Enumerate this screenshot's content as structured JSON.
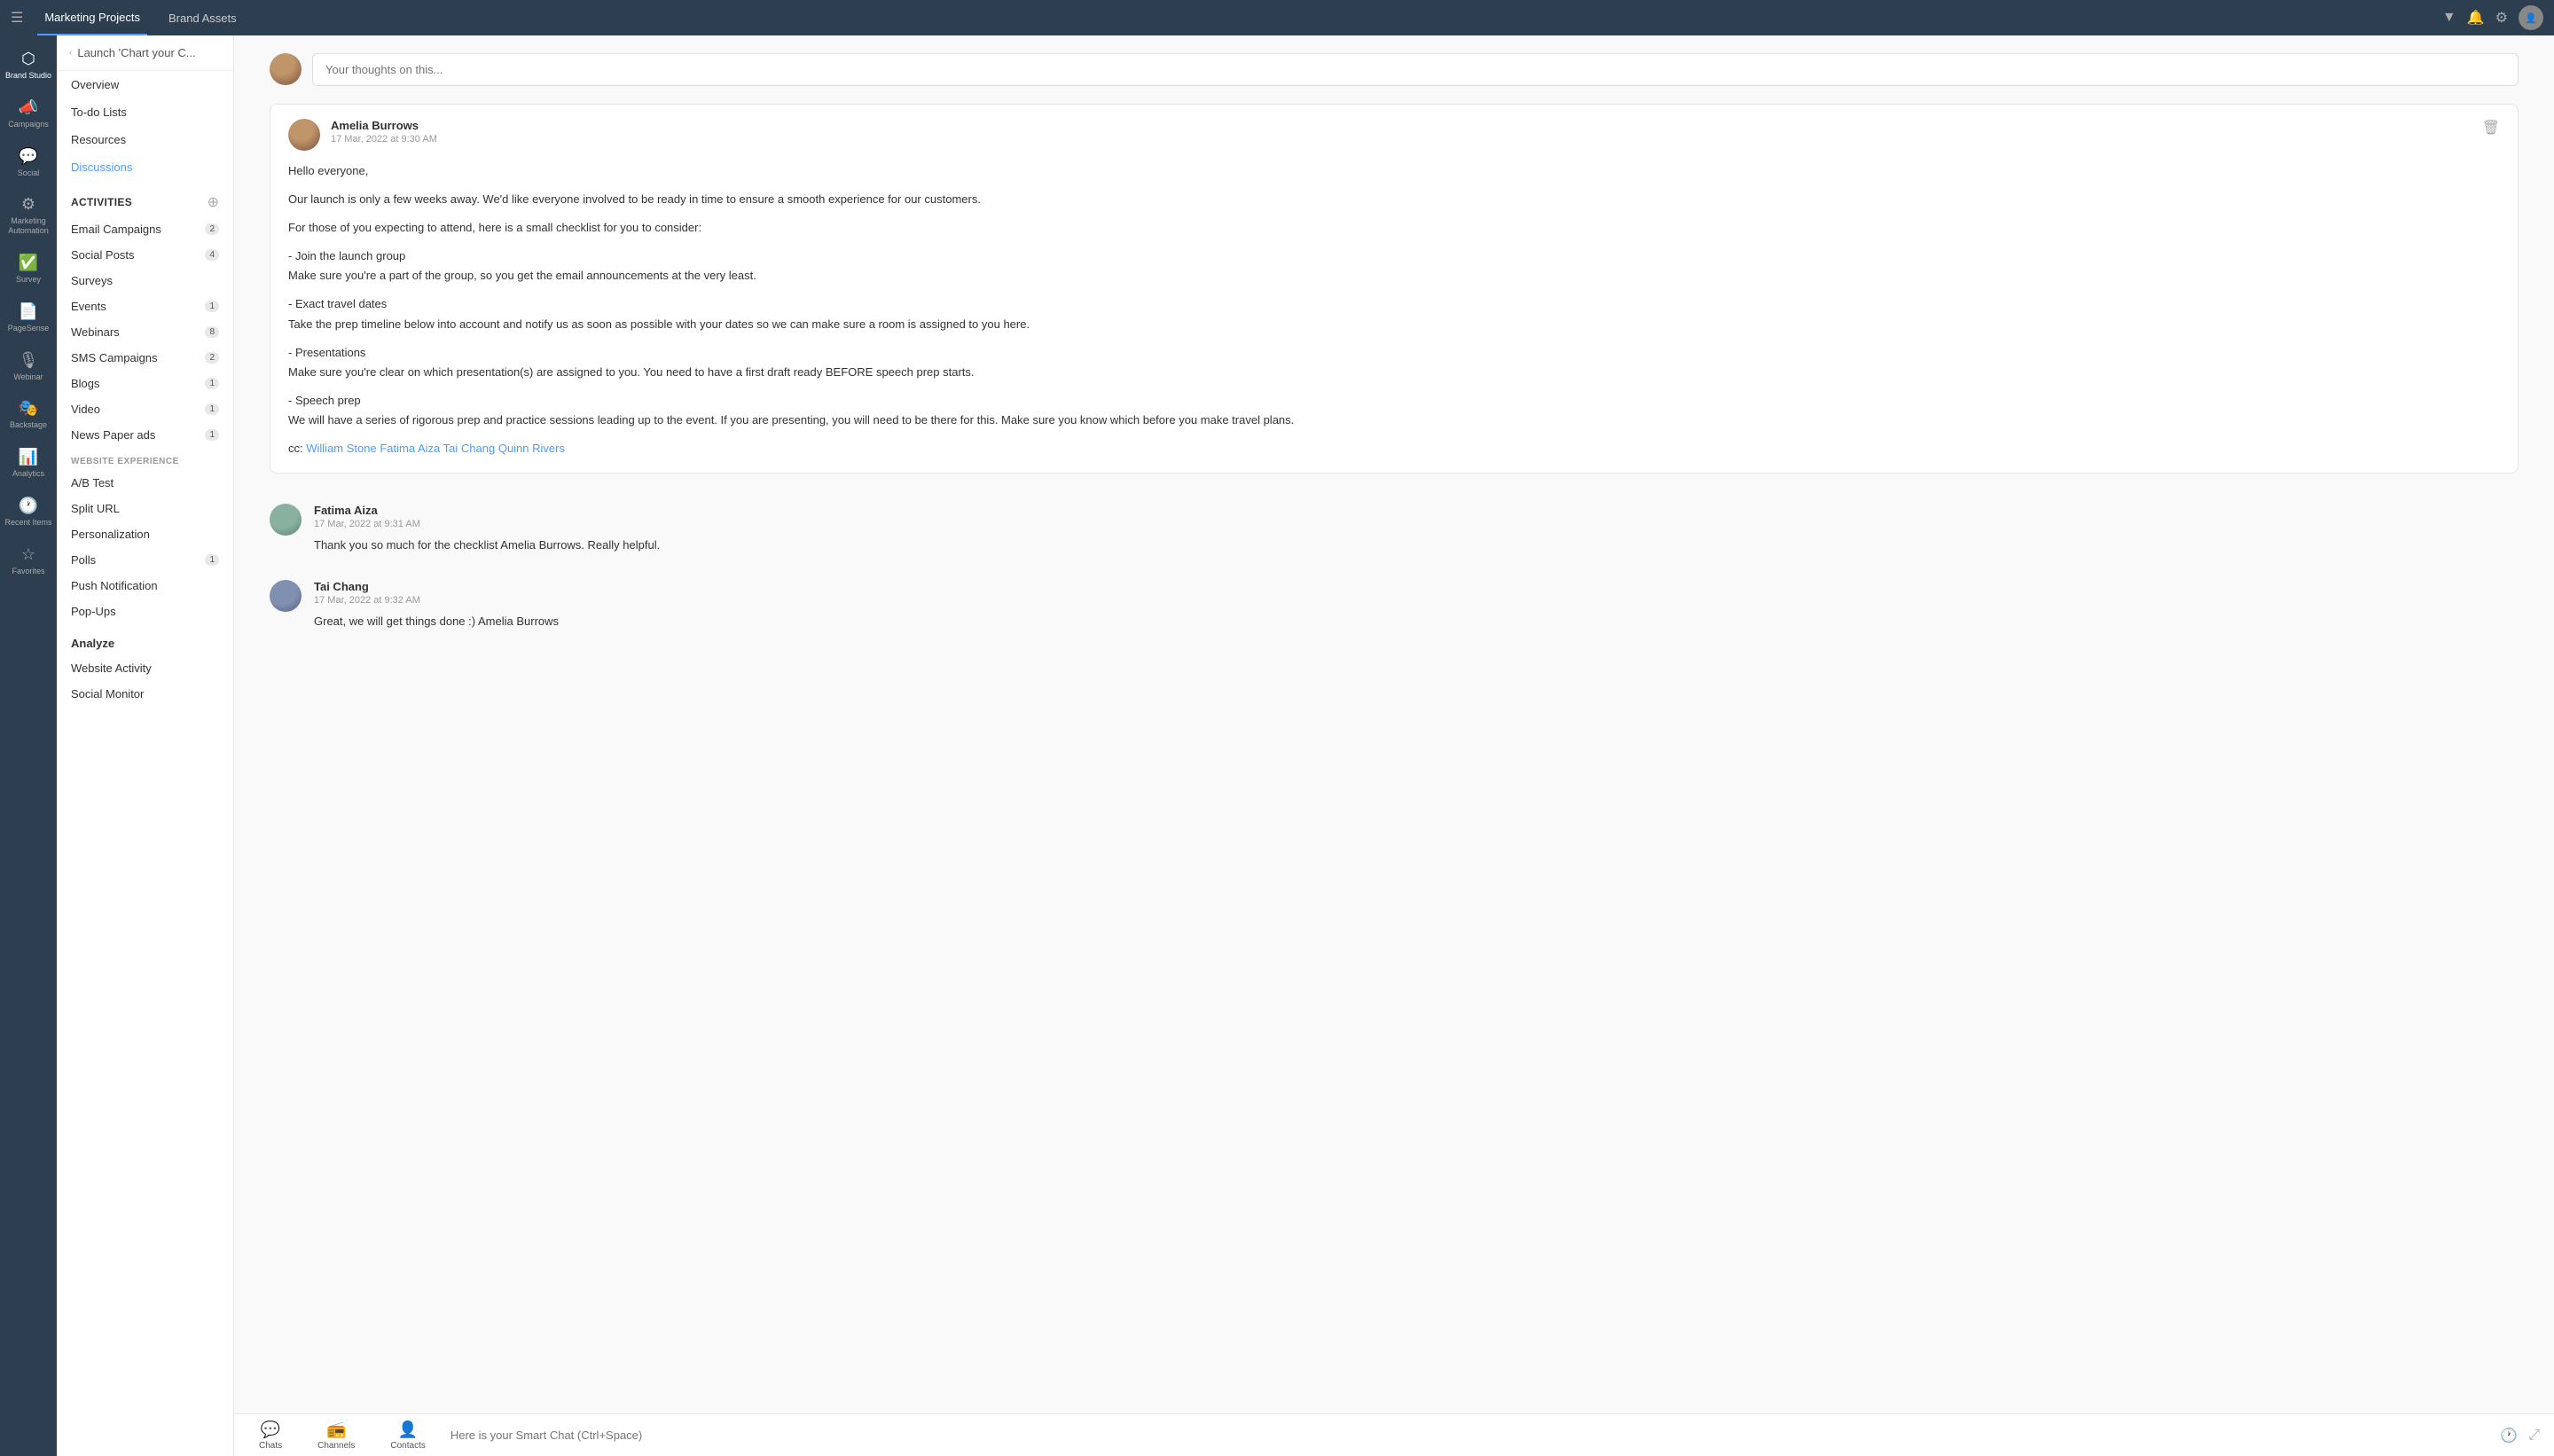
{
  "topbar": {
    "tabs": [
      {
        "label": "Marketing Projects",
        "active": true
      },
      {
        "label": "Brand Assets",
        "active": false
      }
    ],
    "dropdown_icon": "▼"
  },
  "icon_sidebar": {
    "items": [
      {
        "id": "brand-studio",
        "icon": "⬡",
        "label": "Brand Studio",
        "active": true
      },
      {
        "id": "campaigns",
        "icon": "📢",
        "label": "Campaigns",
        "active": false
      },
      {
        "id": "social",
        "icon": "💬",
        "label": "Social",
        "active": false
      },
      {
        "id": "marketing-automation",
        "icon": "⚙",
        "label": "Marketing Automation",
        "active": false
      },
      {
        "id": "survey",
        "icon": "☑",
        "label": "Survey",
        "active": false
      },
      {
        "id": "pagesense",
        "icon": "📄",
        "label": "PageSense",
        "active": false
      },
      {
        "id": "webinar",
        "icon": "🎙",
        "label": "Webinar",
        "active": false
      },
      {
        "id": "backstage",
        "icon": "🎭",
        "label": "Backstage",
        "active": false
      },
      {
        "id": "analytics",
        "icon": "📊",
        "label": "Analytics",
        "active": false
      },
      {
        "id": "recent-items",
        "icon": "🕐",
        "label": "Recent Items",
        "active": false
      },
      {
        "id": "favorites",
        "icon": "☆",
        "label": "Favorites",
        "active": false
      }
    ]
  },
  "nav_sidebar": {
    "back_label": "Launch 'Chart your C...",
    "nav_items": [
      {
        "label": "Overview",
        "active": false
      },
      {
        "label": "To-do Lists",
        "active": false
      },
      {
        "label": "Resources",
        "active": false
      },
      {
        "label": "Discussions",
        "active": true
      }
    ],
    "activities_section": "Activities",
    "activities": [
      {
        "label": "Email Campaigns",
        "badge": "2"
      },
      {
        "label": "Social Posts",
        "badge": "4"
      },
      {
        "label": "Surveys",
        "badge": ""
      },
      {
        "label": "Events",
        "badge": "1"
      },
      {
        "label": "Webinars",
        "badge": "8"
      },
      {
        "label": "SMS Campaigns",
        "badge": "2"
      },
      {
        "label": "Blogs",
        "badge": "1"
      },
      {
        "label": "Video",
        "badge": "1"
      },
      {
        "label": "News Paper ads",
        "badge": "1"
      }
    ],
    "website_experience_section": "WEBSITE EXPERIENCE",
    "website_items": [
      {
        "label": "A/B Test",
        "badge": ""
      },
      {
        "label": "Split URL",
        "badge": ""
      },
      {
        "label": "Personalization",
        "badge": ""
      },
      {
        "label": "Polls",
        "badge": "1"
      },
      {
        "label": "Push Notification",
        "badge": ""
      },
      {
        "label": "Pop-Ups",
        "badge": ""
      }
    ],
    "analyze_section": "Analyze",
    "analyze_items": [
      {
        "label": "Website Activity",
        "badge": ""
      },
      {
        "label": "Social Monitor",
        "badge": ""
      }
    ]
  },
  "discussions": {
    "input_placeholder": "Your thoughts on this...",
    "comments": [
      {
        "id": "comment-1",
        "author": "Amelia Burrows",
        "time": "17 Mar, 2022 at 9:30 AM",
        "body_lines": [
          "Hello everyone,",
          "Our launch is only a few weeks away. We'd like everyone involved to be ready in time to ensure a smooth experience for our customers.",
          "For those of you expecting to attend, here is a small checklist for you to consider:"
        ],
        "bullets": [
          {
            "title": "- Join the launch group",
            "text": "Make sure you're a part of the group, so you get the email announcements at the very least."
          },
          {
            "title": "- Exact travel dates",
            "text": "Take the prep timeline below into account and notify us as soon as possible with your dates so we can make sure a room is assigned to you here."
          },
          {
            "title": "- Presentations",
            "text": "Make sure you're clear on which presentation(s) are assigned to you. You need to have a first draft ready BEFORE speech prep starts."
          },
          {
            "title": "- Speech prep",
            "text": "We will have a series of rigorous prep and practice sessions leading up to the event. If you are presenting, you will need to be there for this. Make sure you know which before you make travel plans."
          }
        ],
        "cc_label": "cc:",
        "cc_links": [
          "William Stone",
          "Fatima Aiza",
          "Tai Chang",
          "Quinn Rivers"
        ]
      }
    ],
    "replies": [
      {
        "id": "reply-1",
        "author": "Fatima Aiza",
        "time": "17 Mar, 2022 at 9:31 AM",
        "text_prefix": "Thank you so much for the checklist ",
        "text_link": "Amelia Burrows",
        "text_suffix": ". Really helpful."
      },
      {
        "id": "reply-2",
        "author": "Tai Chang",
        "time": "17 Mar, 2022 at 9:32 AM",
        "text_prefix": "Great, we will get things done :) ",
        "text_link": "Amelia Burrows",
        "text_suffix": ""
      }
    ]
  },
  "bottom_bar": {
    "items": [
      {
        "id": "chats",
        "icon": "💬",
        "label": "Chats"
      },
      {
        "id": "channels",
        "icon": "📻",
        "label": "Channels"
      },
      {
        "id": "contacts",
        "icon": "👤",
        "label": "Contacts"
      }
    ],
    "smart_chat_placeholder": "Here is your Smart Chat (Ctrl+Space)"
  }
}
